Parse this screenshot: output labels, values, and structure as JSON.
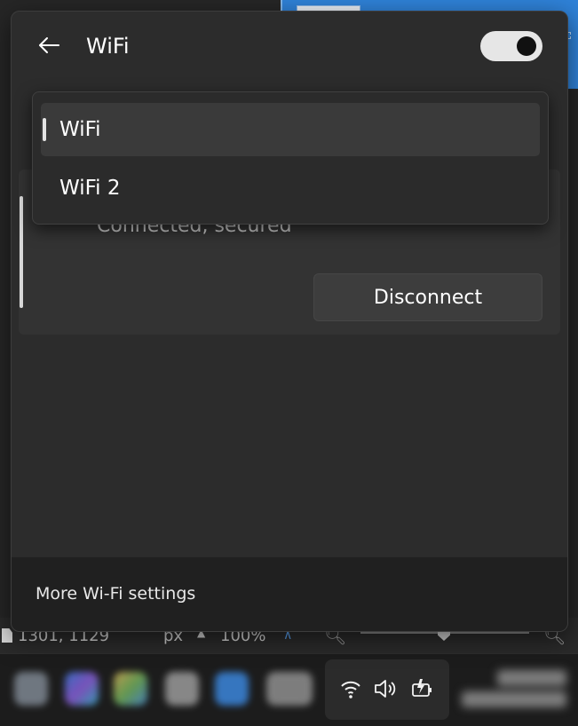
{
  "header": {
    "title": "WiFi",
    "back_icon": "arrow-left-icon",
    "toggle_state": "on"
  },
  "dropdown": {
    "items": [
      {
        "label": "WiFi",
        "selected": true
      },
      {
        "label": "WiFi 2",
        "selected": false
      }
    ]
  },
  "network_card": {
    "status": "Connected, secured",
    "disconnect_label": "Disconnect"
  },
  "footer": {
    "more_settings_label": "More Wi-Fi settings"
  },
  "background_app": {
    "coords": "1301, 1129",
    "unit": "px",
    "zoom": "100%"
  },
  "tray": {
    "icons": [
      "wifi-icon",
      "volume-icon",
      "battery-icon"
    ]
  },
  "colors": {
    "flyout_bg": "#2c2c2c",
    "footer_bg": "#202020",
    "card_bg": "#333333",
    "selected_item_bg": "#3a3a3a",
    "accent_bg_app": "#2f82d8"
  }
}
